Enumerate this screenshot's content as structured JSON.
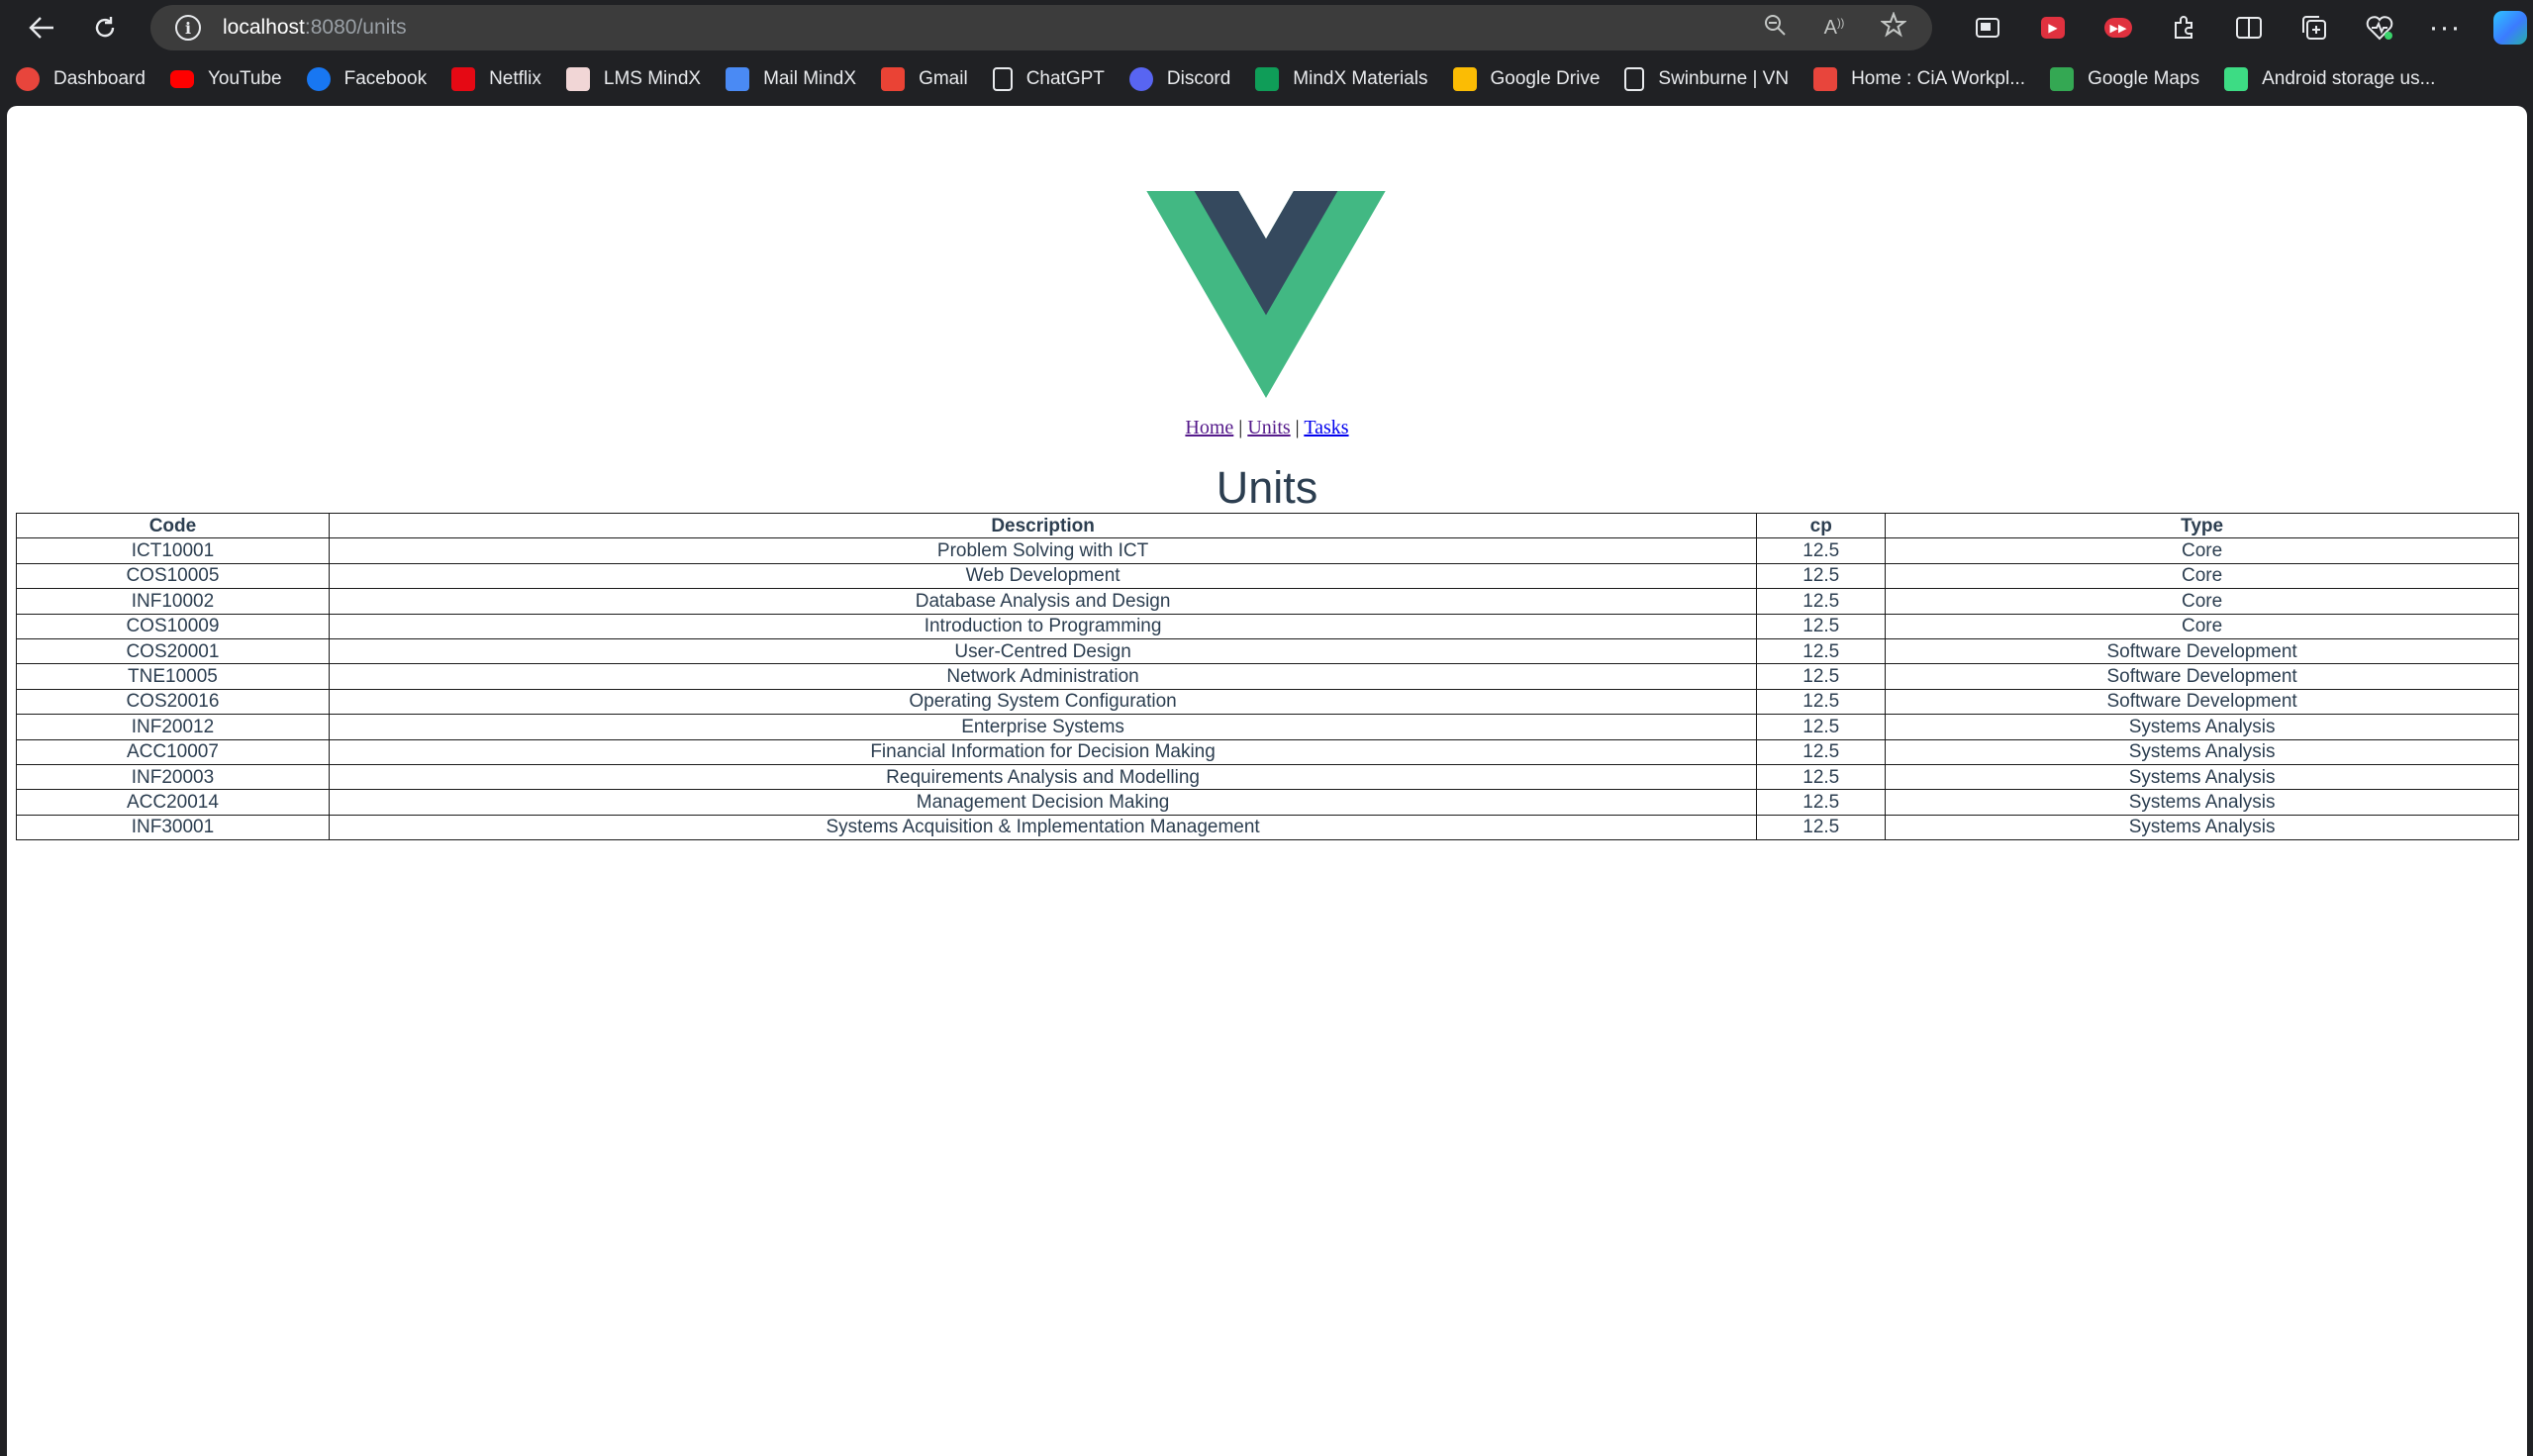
{
  "browser": {
    "url_host": "localhost",
    "url_path": ":8080/units",
    "bookmarks": [
      {
        "label": "Dashboard",
        "icon": "dashboard-icon",
        "color": "#e8453c"
      },
      {
        "label": "YouTube",
        "icon": "youtube-icon",
        "color": "#ff0000"
      },
      {
        "label": "Facebook",
        "icon": "facebook-icon",
        "color": "#1877f2"
      },
      {
        "label": "Netflix",
        "icon": "netflix-icon",
        "color": "#e50914"
      },
      {
        "label": "LMS MindX",
        "icon": "lms-icon",
        "color": "#f1d6d6"
      },
      {
        "label": "Mail MindX",
        "icon": "mail-icon",
        "color": "#4a8af4"
      },
      {
        "label": "Gmail",
        "icon": "gmail-icon",
        "color": "#ea4335"
      },
      {
        "label": "ChatGPT",
        "icon": "chatgpt-icon",
        "color": "#e8eaed"
      },
      {
        "label": "Discord",
        "icon": "discord-icon",
        "color": "#5865f2"
      },
      {
        "label": "MindX Materials",
        "icon": "sheets-icon",
        "color": "#0f9d58"
      },
      {
        "label": "Google Drive",
        "icon": "drive-icon",
        "color": "#fbbc04"
      },
      {
        "label": "Swinburne | VN",
        "icon": "page-icon",
        "color": "#e8eaed"
      },
      {
        "label": "Home : CiA Workpl...",
        "icon": "cia-icon",
        "color": "#e8453c"
      },
      {
        "label": "Google Maps",
        "icon": "maps-icon",
        "color": "#34a853"
      },
      {
        "label": "Android storage us...",
        "icon": "android-icon",
        "color": "#3ddc84"
      }
    ]
  },
  "nav": {
    "home": "Home",
    "units": "Units",
    "tasks": "Tasks",
    "separator": "|"
  },
  "page": {
    "title": "Units"
  },
  "table": {
    "headers": [
      "Code",
      "Description",
      "cp",
      "Type"
    ],
    "rows": [
      [
        "ICT10001",
        "Problem Solving with ICT",
        "12.5",
        "Core"
      ],
      [
        "COS10005",
        "Web Development",
        "12.5",
        "Core"
      ],
      [
        "INF10002",
        "Database Analysis and Design",
        "12.5",
        "Core"
      ],
      [
        "COS10009",
        "Introduction to Programming",
        "12.5",
        "Core"
      ],
      [
        "COS20001",
        "User-Centred Design",
        "12.5",
        "Software Development"
      ],
      [
        "TNE10005",
        "Network Administration",
        "12.5",
        "Software Development"
      ],
      [
        "COS20016",
        "Operating System Configuration",
        "12.5",
        "Software Development"
      ],
      [
        "INF20012",
        "Enterprise Systems",
        "12.5",
        "Systems Analysis"
      ],
      [
        "ACC10007",
        "Financial Information for Decision Making",
        "12.5",
        "Systems Analysis"
      ],
      [
        "INF20003",
        "Requirements Analysis and Modelling",
        "12.5",
        "Systems Analysis"
      ],
      [
        "ACC20014",
        "Management Decision Making",
        "12.5",
        "Systems Analysis"
      ],
      [
        "INF30001",
        "Systems Acquisition & Implementation Management",
        "12.5",
        "Systems Analysis"
      ]
    ]
  },
  "colors": {
    "vue_green": "#42b883",
    "vue_dark": "#35495e",
    "text": "#2c3e50"
  }
}
